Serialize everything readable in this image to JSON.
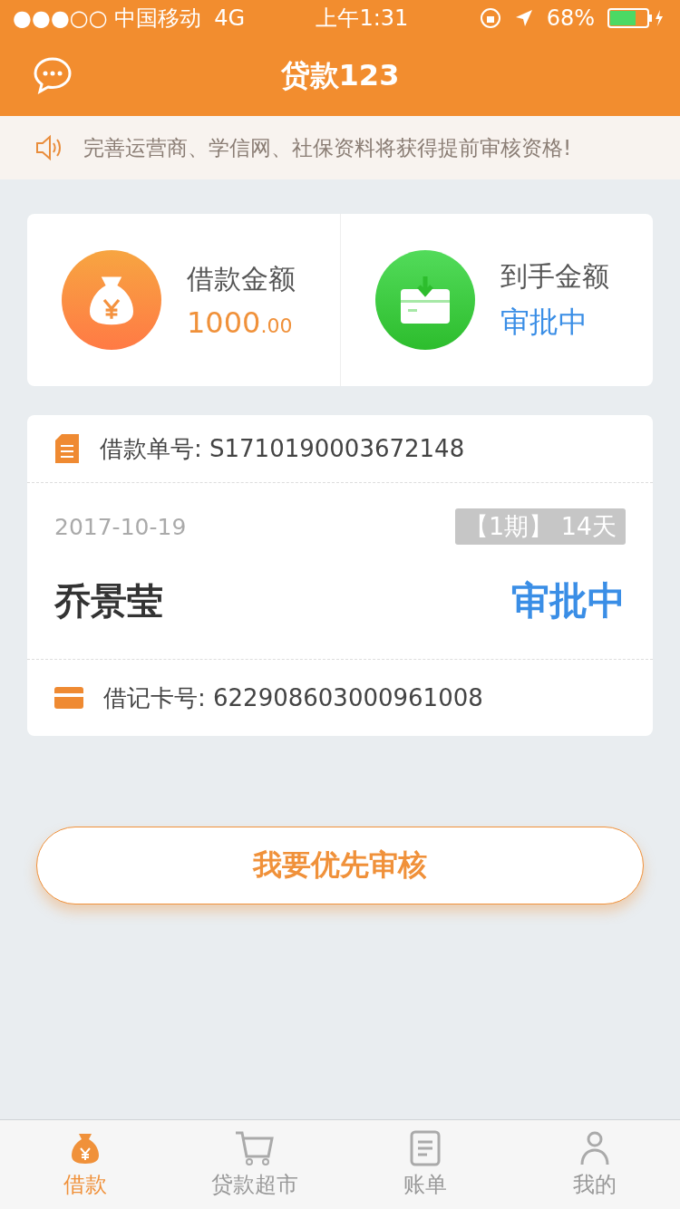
{
  "status_bar": {
    "carrier": "●●●○○ 中国移动",
    "network": "4G",
    "time": "上午1:31",
    "battery": "68%"
  },
  "nav": {
    "title": "贷款123"
  },
  "notice": {
    "text": "完善运营商、学信网、社保资料将获得提前审核资格!"
  },
  "summary": [
    {
      "kind": "amount",
      "label": "借款金额",
      "value": "1000",
      "decimal": ".00"
    },
    {
      "kind": "status",
      "label": "到手金额",
      "value": "审批中"
    }
  ],
  "order": {
    "number_label": "借款单号: S1710190003672148",
    "date": "2017-10-19",
    "term": "【1期】 14天",
    "name": "乔景莹",
    "status": "审批中",
    "card_label": "借记卡号: 622908603000961008"
  },
  "priority_button": "我要优先审核",
  "tabs": [
    {
      "label": "借款",
      "kind": "bag",
      "selected": true
    },
    {
      "label": "贷款超市",
      "kind": "cart",
      "selected": false
    },
    {
      "label": "账单",
      "kind": "doc",
      "selected": false
    },
    {
      "label": "我的",
      "kind": "user",
      "selected": false
    }
  ]
}
